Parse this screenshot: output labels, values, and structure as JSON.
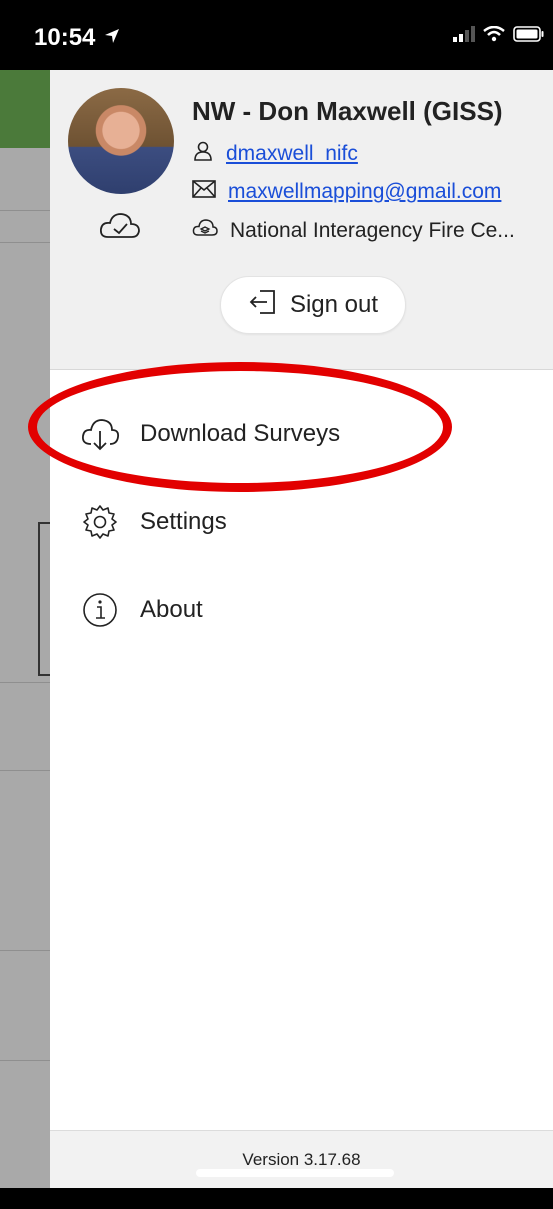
{
  "status_bar": {
    "time": "10:54",
    "icons": [
      "location-arrow-icon",
      "signal-icon",
      "wifi-icon",
      "battery-icon"
    ]
  },
  "profile": {
    "name": "NW - Don Maxwell (GISS)",
    "username": "dmaxwell_nifc",
    "email": "maxwellmapping@gmail.com",
    "organization": "National Interagency Fire Ce...",
    "sign_out_label": "Sign out"
  },
  "menu": {
    "items": [
      {
        "label": "Download Surveys",
        "icon": "cloud-download-icon"
      },
      {
        "label": "Settings",
        "icon": "gear-icon"
      },
      {
        "label": "About",
        "icon": "info-icon"
      }
    ]
  },
  "footer": {
    "version": "Version 3.17.68"
  },
  "colors": {
    "link": "#1a4ed8",
    "highlight": "#e20000",
    "header_bg": "#f0f0f0",
    "app_bar_green": "#4b7a3a"
  }
}
